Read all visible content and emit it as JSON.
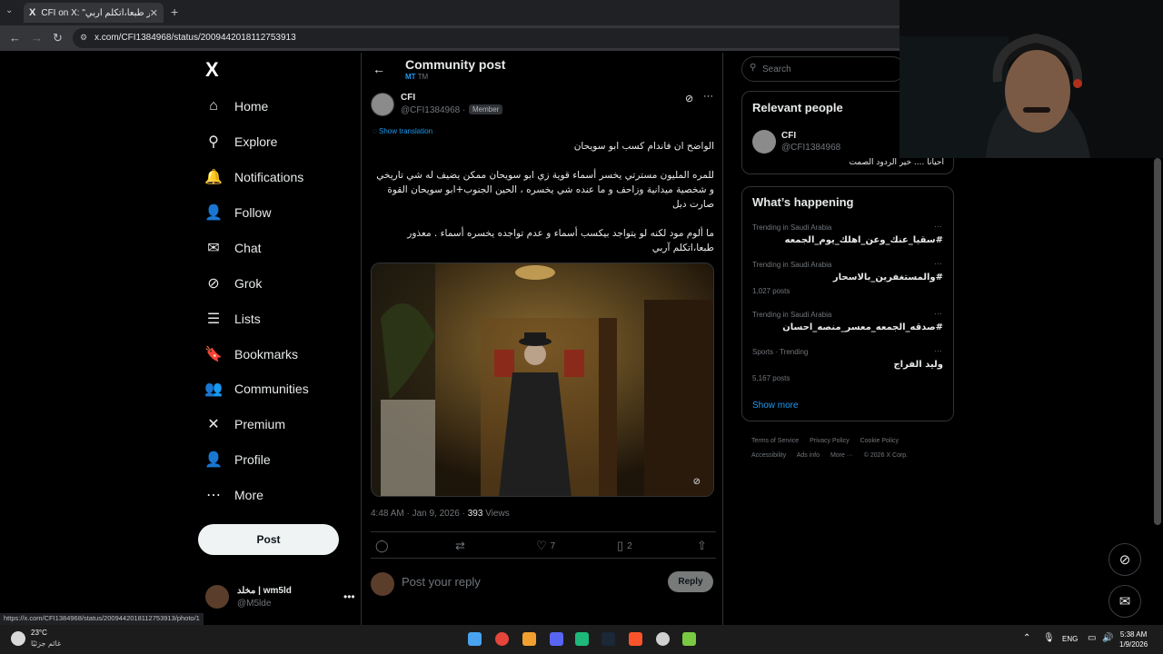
{
  "browser": {
    "tab_title": "CFI on X: \"معذور طبعا،اتكلم آربي\"",
    "tab_favicon": "X",
    "url": "x.com/CFI1384968/status/2009442018112753913",
    "hover_url": "https://x.com/CFI1384968/status/2009442018112753913/photo/1"
  },
  "sidebar": {
    "logo": "X",
    "items": [
      {
        "label": "Home",
        "icon": "home-icon",
        "glyph": "⌂"
      },
      {
        "label": "Explore",
        "icon": "search-icon",
        "glyph": "⚲"
      },
      {
        "label": "Notifications",
        "icon": "bell-icon",
        "glyph": "🔔"
      },
      {
        "label": "Follow",
        "icon": "person-add-icon",
        "glyph": "👤"
      },
      {
        "label": "Chat",
        "icon": "mail-icon",
        "glyph": "✉"
      },
      {
        "label": "Grok",
        "icon": "grok-icon",
        "glyph": "⊘"
      },
      {
        "label": "Lists",
        "icon": "list-icon",
        "glyph": "☰"
      },
      {
        "label": "Bookmarks",
        "icon": "bookmark-icon",
        "glyph": "🔖"
      },
      {
        "label": "Communities",
        "icon": "people-icon",
        "glyph": "👥"
      },
      {
        "label": "Premium",
        "icon": "x-premium-icon",
        "glyph": "✕"
      },
      {
        "label": "Profile",
        "icon": "profile-icon",
        "glyph": "👤"
      },
      {
        "label": "More",
        "icon": "more-circle-icon",
        "glyph": "⋯"
      }
    ],
    "post_label": "Post",
    "account": {
      "name": "مخلد | wm5ld",
      "handle": "@M5lde"
    }
  },
  "header": {
    "title": "Community post",
    "sub_link": "MT",
    "sub_extra": "TM"
  },
  "post": {
    "author_name": "CFI",
    "author_handle": "@CFI1384968 ·",
    "badge": "Member",
    "show_translation": "Show translation",
    "paragraphs": [
      "الواضح ان فاندام كسب ابو سويحان",
      "للمره المليون مسترتي يخسر أسماء قوية زي ابو سويحان ممكن يضيف له شي تاريخي و شخصية  ميدانية وزاحف و ما عنده شي يخسره ، الحين الجنوب+ابو سويحان القوة صارت دبل",
      "ما ألوم مود لكنه لو يتواجد بيكسب أسماء و عدم تواجده يخسره أسماء . معذور طبعا،اتكلم آربي"
    ],
    "timestamp": "4:48 AM · Jan 9, 2026 ·",
    "views_count": "393",
    "views_label": "Views",
    "likes": "7",
    "bookmarks": "2",
    "reply_placeholder": "Post your reply",
    "reply_button": "Reply"
  },
  "right": {
    "search_placeholder": "Search",
    "relevant_title": "Relevant people",
    "relevant_name": "CFI",
    "relevant_handle": "@CFI1384968",
    "relevant_bio": "احيانا .... خير الردود الصمت",
    "happening_title": "What’s happening",
    "trends": [
      {
        "meta": "Trending in Saudi Arabia",
        "name": "#سقيا_عنك_وعن_اهلك_يوم_الجمعه",
        "count": ""
      },
      {
        "meta": "Trending in Saudi Arabia",
        "name": "#والمستغفرين_بالاسحار",
        "count": "1,027 posts"
      },
      {
        "meta": "Trending in Saudi Arabia",
        "name": "#صدقه_الجمعه_معسر_منصه_احسان",
        "count": ""
      },
      {
        "meta": "Sports · Trending",
        "name": "وليد الفراج",
        "count": "5,167 posts"
      }
    ],
    "show_more": "Show more",
    "footer": [
      "Terms of Service",
      "Privacy Policy",
      "Cookie Policy",
      "Accessibility",
      "Ads info",
      "More ···",
      "© 2026 X Corp."
    ]
  },
  "taskbar": {
    "temp": "23°C",
    "weather_desc": "غائم جزئيًا",
    "lang": "ENG",
    "time": "5:38 AM",
    "date": "1/9/2026"
  },
  "colors": {
    "accent": "#1d9bf0",
    "background": "#000000",
    "border": "#2f3336"
  }
}
